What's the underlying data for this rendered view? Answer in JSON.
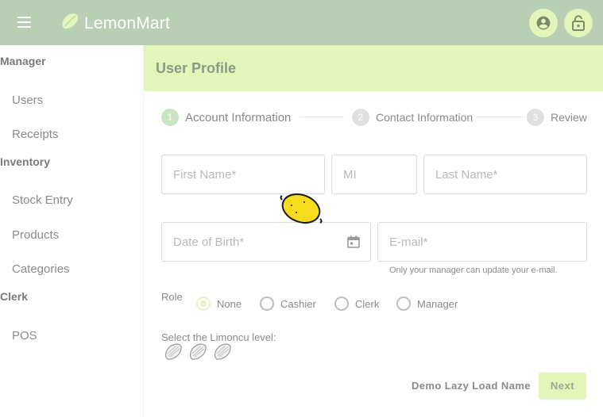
{
  "app": {
    "title": "LemonMart"
  },
  "colors": {
    "toolbar": "#b8cfb4",
    "accent_light": "#e4f5ba",
    "lemon_yellow": "#f5dc1e"
  },
  "icons": {
    "menu": "menu-icon",
    "logo": "lemon-logo-icon",
    "account": "account-circle-icon",
    "logout": "lock-open-icon",
    "calendar": "calendar-icon",
    "limoncu": "lemon-outline-icon"
  },
  "sidebar": {
    "sections": [
      {
        "header": "Manager",
        "items": [
          "Users",
          "Receipts"
        ]
      },
      {
        "header": "Inventory",
        "items": [
          "Stock Entry",
          "Products",
          "Categories"
        ]
      },
      {
        "header": "Clerk",
        "items": [
          "POS"
        ]
      }
    ]
  },
  "page": {
    "title": "User Profile"
  },
  "stepper": {
    "steps": [
      {
        "number": "1",
        "label": "Account Information"
      },
      {
        "number": "2",
        "label": "Contact Information"
      },
      {
        "number": "3",
        "label": "Review"
      }
    ]
  },
  "form": {
    "first_name": {
      "placeholder": "First Name*",
      "value": ""
    },
    "mi": {
      "placeholder": "MI",
      "value": ""
    },
    "last_name": {
      "placeholder": "Last Name*",
      "value": ""
    },
    "dob": {
      "placeholder": "Date of Birth*",
      "value": ""
    },
    "email": {
      "placeholder": "E-mail*",
      "value": "",
      "hint": "Only your manager can update your e-mail."
    },
    "role": {
      "label": "Role",
      "options": [
        "None",
        "Cashier",
        "Clerk",
        "Manager"
      ],
      "selected": "None"
    },
    "limoncu": {
      "label": "Select the Limoncu level:",
      "max": 3,
      "value": 0
    },
    "demo_label": "Demo Lazy Load Name",
    "next_label": "Next"
  }
}
